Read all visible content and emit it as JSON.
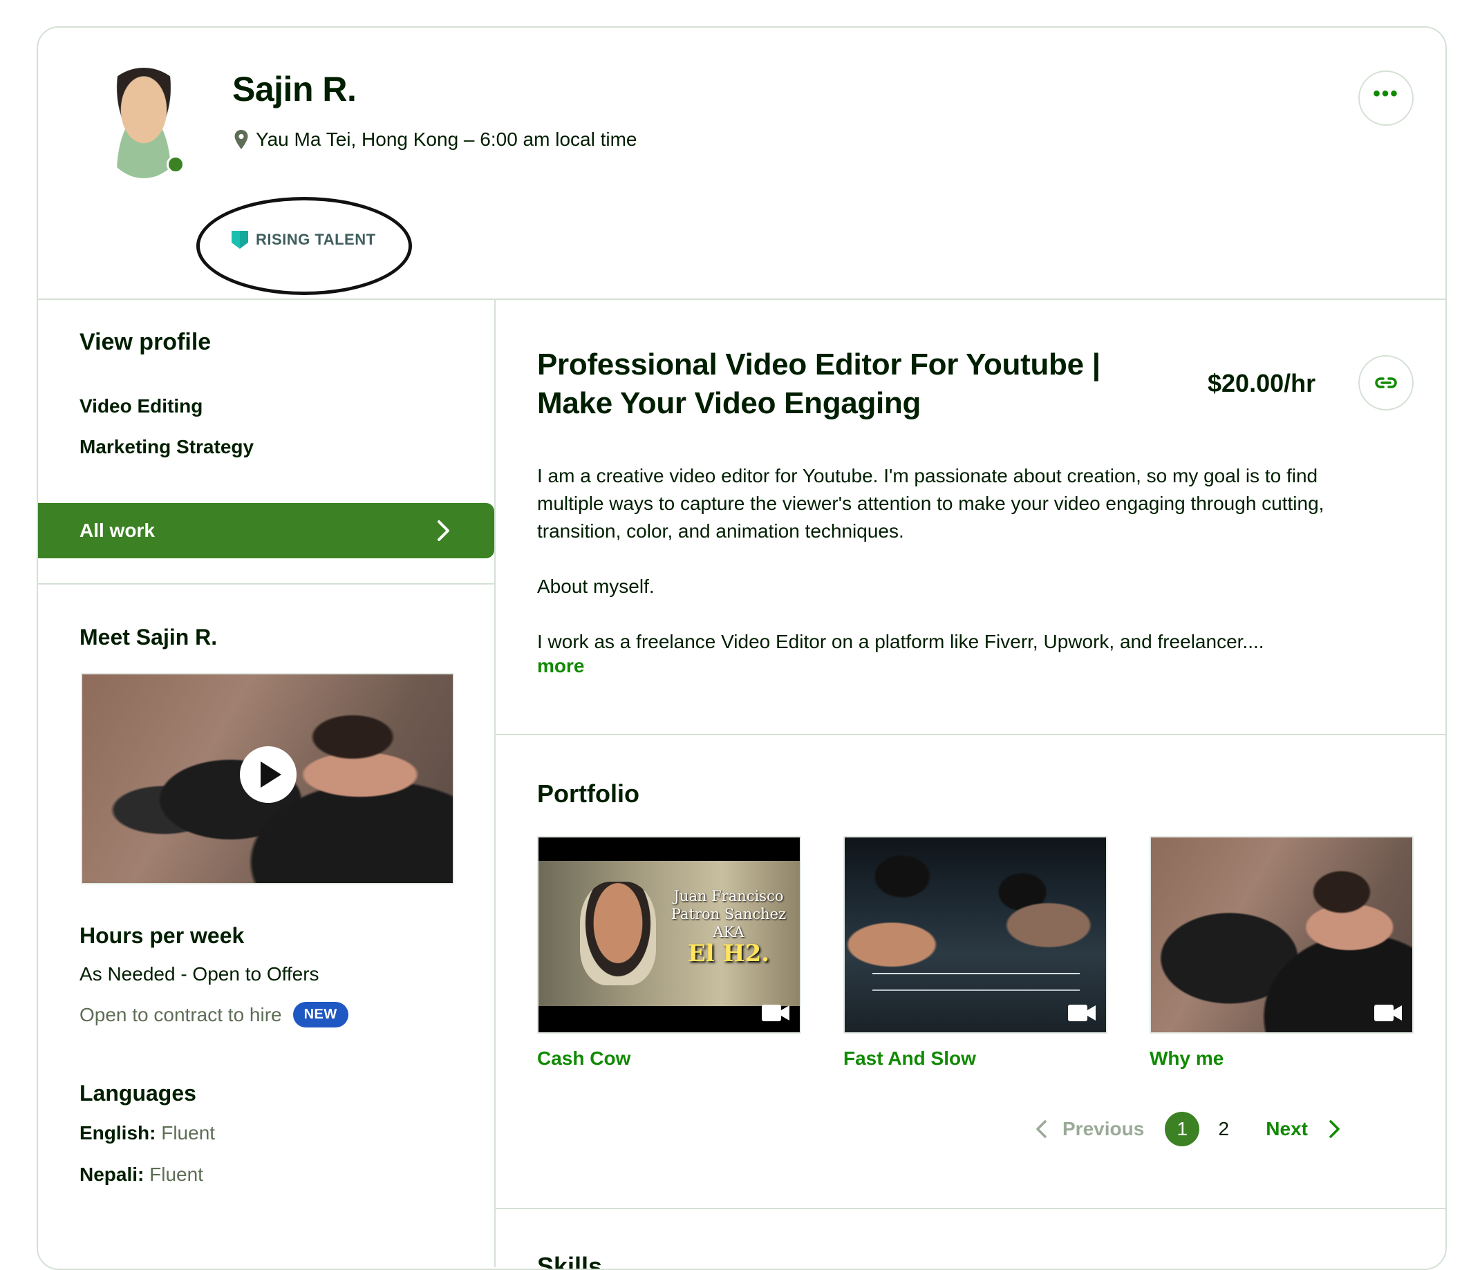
{
  "profile": {
    "name": "Sajin R.",
    "location": "Yau Ma Tei, Hong Kong – 6:00 am local time",
    "badge": "RISING TALENT",
    "more_label": "•••"
  },
  "sidebar": {
    "view_profile": "View profile",
    "items": [
      {
        "label": "Video Editing"
      },
      {
        "label": "Marketing Strategy"
      },
      {
        "label": "All work"
      }
    ],
    "meet_title": "Meet Sajin R.",
    "hours_title": "Hours per week",
    "hours_value": "As Needed - Open to Offers",
    "contract_text": "Open to contract to hire",
    "new_badge": "NEW",
    "languages_title": "Languages",
    "languages": [
      {
        "name": "English:",
        "level": "Fluent"
      },
      {
        "name": "Nepali:",
        "level": "Fluent"
      }
    ]
  },
  "main": {
    "title": "Professional Video Editor For Youtube | Make Your Video Engaging",
    "rate": "$20.00/hr",
    "description": [
      "I am a creative video editor for Youtube. I'm passionate about creation, so my goal is to find multiple ways to capture the viewer's attention to make your video engaging through cutting, transition, color, and animation techniques.",
      "About myself.",
      "I work as a freelance Video Editor on a platform like Fiverr, Upwork, and freelancer...."
    ],
    "more_label": "more",
    "portfolio_title": "Portfolio",
    "portfolio": [
      {
        "title": "Cash Cow",
        "thumb_line1": "Juan Francisco Patron Sanchez AKA",
        "thumb_line2": "El H2."
      },
      {
        "title": "Fast And Slow"
      },
      {
        "title": "Why me"
      }
    ],
    "pager": {
      "previous": "Previous",
      "pages": [
        "1",
        "2"
      ],
      "next": "Next"
    },
    "skills_title": "Skills"
  },
  "colors": {
    "brand_green": "#3c8224",
    "link_green": "#108a00",
    "new_badge": "#1f57c3",
    "border": "#d5e0d5"
  },
  "icons": [
    "location-pin-icon",
    "shield-icon",
    "more-options-icon",
    "chevron-right-icon",
    "play-icon",
    "link-icon",
    "video-camera-icon",
    "chevron-left-icon"
  ]
}
